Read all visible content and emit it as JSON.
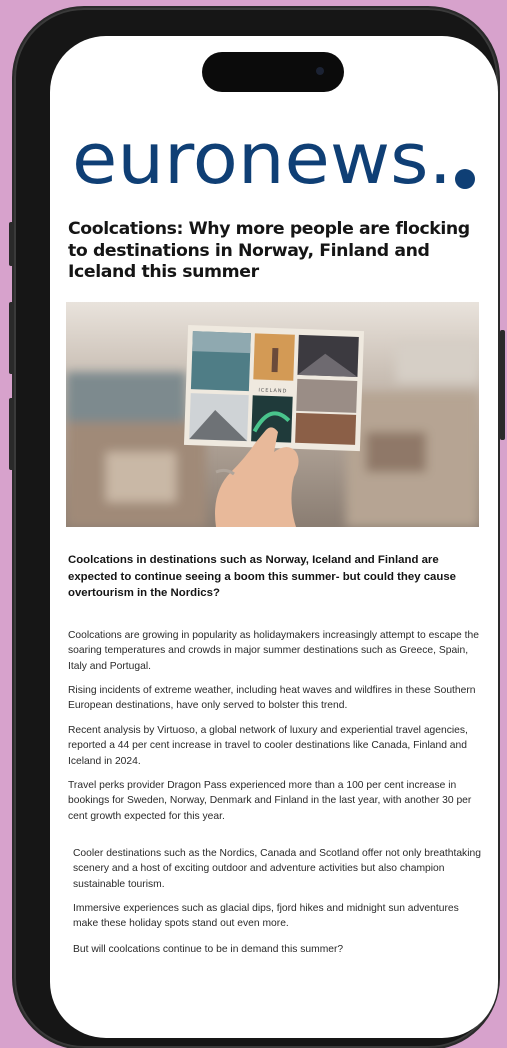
{
  "brand": {
    "name": "euronews.",
    "colors": {
      "blue": "#0f3f75",
      "dot": "#0f3f75"
    }
  },
  "article": {
    "headline": "Coolcations: Why more people are flocking to destinations in Norway, Finland and Iceland this summer",
    "image": {
      "postcard_label": "ICELAND",
      "icon": "postcard-photo"
    },
    "summary": "Coolcations in destinations such as Norway, Iceland and Finland are expected to continue seeing a boom this summer- but could they cause overtourism in the Nordics?",
    "paragraphs": [
      "Coolcations are growing in popularity as holidaymakers increasingly attempt to escape the soaring temperatures and crowds in major summer destinations such as Greece, Spain, Italy and Portugal.",
      "Rising incidents of extreme weather, including heat waves and wildfires in these Southern European destinations, have only served to bolster this trend.",
      "Recent analysis by Virtuoso, a global network of luxury and experiential travel agencies, reported a 44 per cent increase in travel to cooler destinations like Canada, Finland and Iceland in 2024.",
      "Travel perks provider Dragon Pass experienced more than a 100 per cent increase in bookings for Sweden, Norway, Denmark and Finland in the last year, with another 30 per cent growth expected for this year.",
      "Cooler destinations such as the Nordics, Canada and Scotland offer not only breathtaking scenery and a host of exciting outdoor and adventure activities but also champion sustainable tourism.",
      "Immersive experiences such as glacial dips, fjord hikes and midnight sun adventures make these holiday spots stand out even more.",
      "But will coolcations continue to be in demand this summer?"
    ]
  }
}
